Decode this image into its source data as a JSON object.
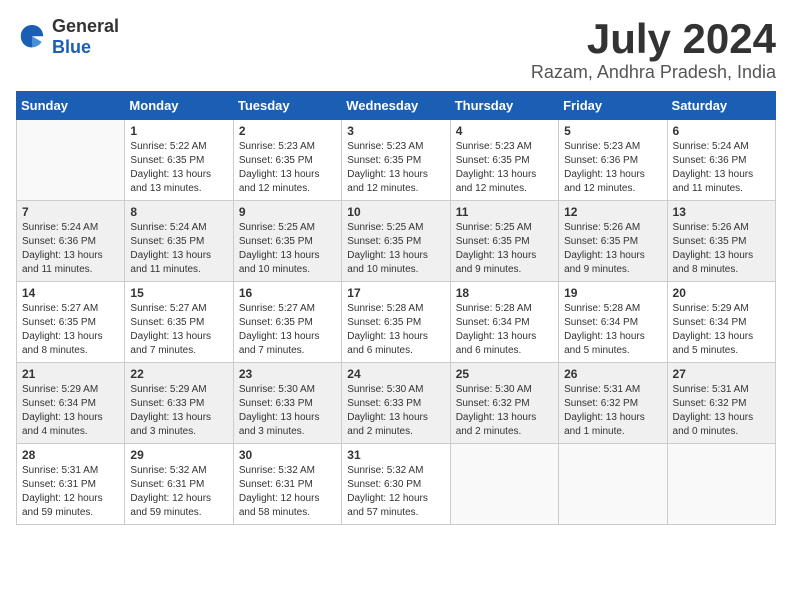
{
  "header": {
    "logo_general": "General",
    "logo_blue": "Blue",
    "title": "July 2024",
    "subtitle": "Razam, Andhra Pradesh, India"
  },
  "calendar": {
    "days_of_week": [
      "Sunday",
      "Monday",
      "Tuesday",
      "Wednesday",
      "Thursday",
      "Friday",
      "Saturday"
    ],
    "weeks": [
      [
        {
          "day": "",
          "info": ""
        },
        {
          "day": "1",
          "info": "Sunrise: 5:22 AM\nSunset: 6:35 PM\nDaylight: 13 hours\nand 13 minutes."
        },
        {
          "day": "2",
          "info": "Sunrise: 5:23 AM\nSunset: 6:35 PM\nDaylight: 13 hours\nand 12 minutes."
        },
        {
          "day": "3",
          "info": "Sunrise: 5:23 AM\nSunset: 6:35 PM\nDaylight: 13 hours\nand 12 minutes."
        },
        {
          "day": "4",
          "info": "Sunrise: 5:23 AM\nSunset: 6:35 PM\nDaylight: 13 hours\nand 12 minutes."
        },
        {
          "day": "5",
          "info": "Sunrise: 5:23 AM\nSunset: 6:36 PM\nDaylight: 13 hours\nand 12 minutes."
        },
        {
          "day": "6",
          "info": "Sunrise: 5:24 AM\nSunset: 6:36 PM\nDaylight: 13 hours\nand 11 minutes."
        }
      ],
      [
        {
          "day": "7",
          "info": "Sunrise: 5:24 AM\nSunset: 6:36 PM\nDaylight: 13 hours\nand 11 minutes."
        },
        {
          "day": "8",
          "info": "Sunrise: 5:24 AM\nSunset: 6:35 PM\nDaylight: 13 hours\nand 11 minutes."
        },
        {
          "day": "9",
          "info": "Sunrise: 5:25 AM\nSunset: 6:35 PM\nDaylight: 13 hours\nand 10 minutes."
        },
        {
          "day": "10",
          "info": "Sunrise: 5:25 AM\nSunset: 6:35 PM\nDaylight: 13 hours\nand 10 minutes."
        },
        {
          "day": "11",
          "info": "Sunrise: 5:25 AM\nSunset: 6:35 PM\nDaylight: 13 hours\nand 9 minutes."
        },
        {
          "day": "12",
          "info": "Sunrise: 5:26 AM\nSunset: 6:35 PM\nDaylight: 13 hours\nand 9 minutes."
        },
        {
          "day": "13",
          "info": "Sunrise: 5:26 AM\nSunset: 6:35 PM\nDaylight: 13 hours\nand 8 minutes."
        }
      ],
      [
        {
          "day": "14",
          "info": "Sunrise: 5:27 AM\nSunset: 6:35 PM\nDaylight: 13 hours\nand 8 minutes."
        },
        {
          "day": "15",
          "info": "Sunrise: 5:27 AM\nSunset: 6:35 PM\nDaylight: 13 hours\nand 7 minutes."
        },
        {
          "day": "16",
          "info": "Sunrise: 5:27 AM\nSunset: 6:35 PM\nDaylight: 13 hours\nand 7 minutes."
        },
        {
          "day": "17",
          "info": "Sunrise: 5:28 AM\nSunset: 6:35 PM\nDaylight: 13 hours\nand 6 minutes."
        },
        {
          "day": "18",
          "info": "Sunrise: 5:28 AM\nSunset: 6:34 PM\nDaylight: 13 hours\nand 6 minutes."
        },
        {
          "day": "19",
          "info": "Sunrise: 5:28 AM\nSunset: 6:34 PM\nDaylight: 13 hours\nand 5 minutes."
        },
        {
          "day": "20",
          "info": "Sunrise: 5:29 AM\nSunset: 6:34 PM\nDaylight: 13 hours\nand 5 minutes."
        }
      ],
      [
        {
          "day": "21",
          "info": "Sunrise: 5:29 AM\nSunset: 6:34 PM\nDaylight: 13 hours\nand 4 minutes."
        },
        {
          "day": "22",
          "info": "Sunrise: 5:29 AM\nSunset: 6:33 PM\nDaylight: 13 hours\nand 3 minutes."
        },
        {
          "day": "23",
          "info": "Sunrise: 5:30 AM\nSunset: 6:33 PM\nDaylight: 13 hours\nand 3 minutes."
        },
        {
          "day": "24",
          "info": "Sunrise: 5:30 AM\nSunset: 6:33 PM\nDaylight: 13 hours\nand 2 minutes."
        },
        {
          "day": "25",
          "info": "Sunrise: 5:30 AM\nSunset: 6:32 PM\nDaylight: 13 hours\nand 2 minutes."
        },
        {
          "day": "26",
          "info": "Sunrise: 5:31 AM\nSunset: 6:32 PM\nDaylight: 13 hours\nand 1 minute."
        },
        {
          "day": "27",
          "info": "Sunrise: 5:31 AM\nSunset: 6:32 PM\nDaylight: 13 hours\nand 0 minutes."
        }
      ],
      [
        {
          "day": "28",
          "info": "Sunrise: 5:31 AM\nSunset: 6:31 PM\nDaylight: 12 hours\nand 59 minutes."
        },
        {
          "day": "29",
          "info": "Sunrise: 5:32 AM\nSunset: 6:31 PM\nDaylight: 12 hours\nand 59 minutes."
        },
        {
          "day": "30",
          "info": "Sunrise: 5:32 AM\nSunset: 6:31 PM\nDaylight: 12 hours\nand 58 minutes."
        },
        {
          "day": "31",
          "info": "Sunrise: 5:32 AM\nSunset: 6:30 PM\nDaylight: 12 hours\nand 57 minutes."
        },
        {
          "day": "",
          "info": ""
        },
        {
          "day": "",
          "info": ""
        },
        {
          "day": "",
          "info": ""
        }
      ]
    ]
  }
}
